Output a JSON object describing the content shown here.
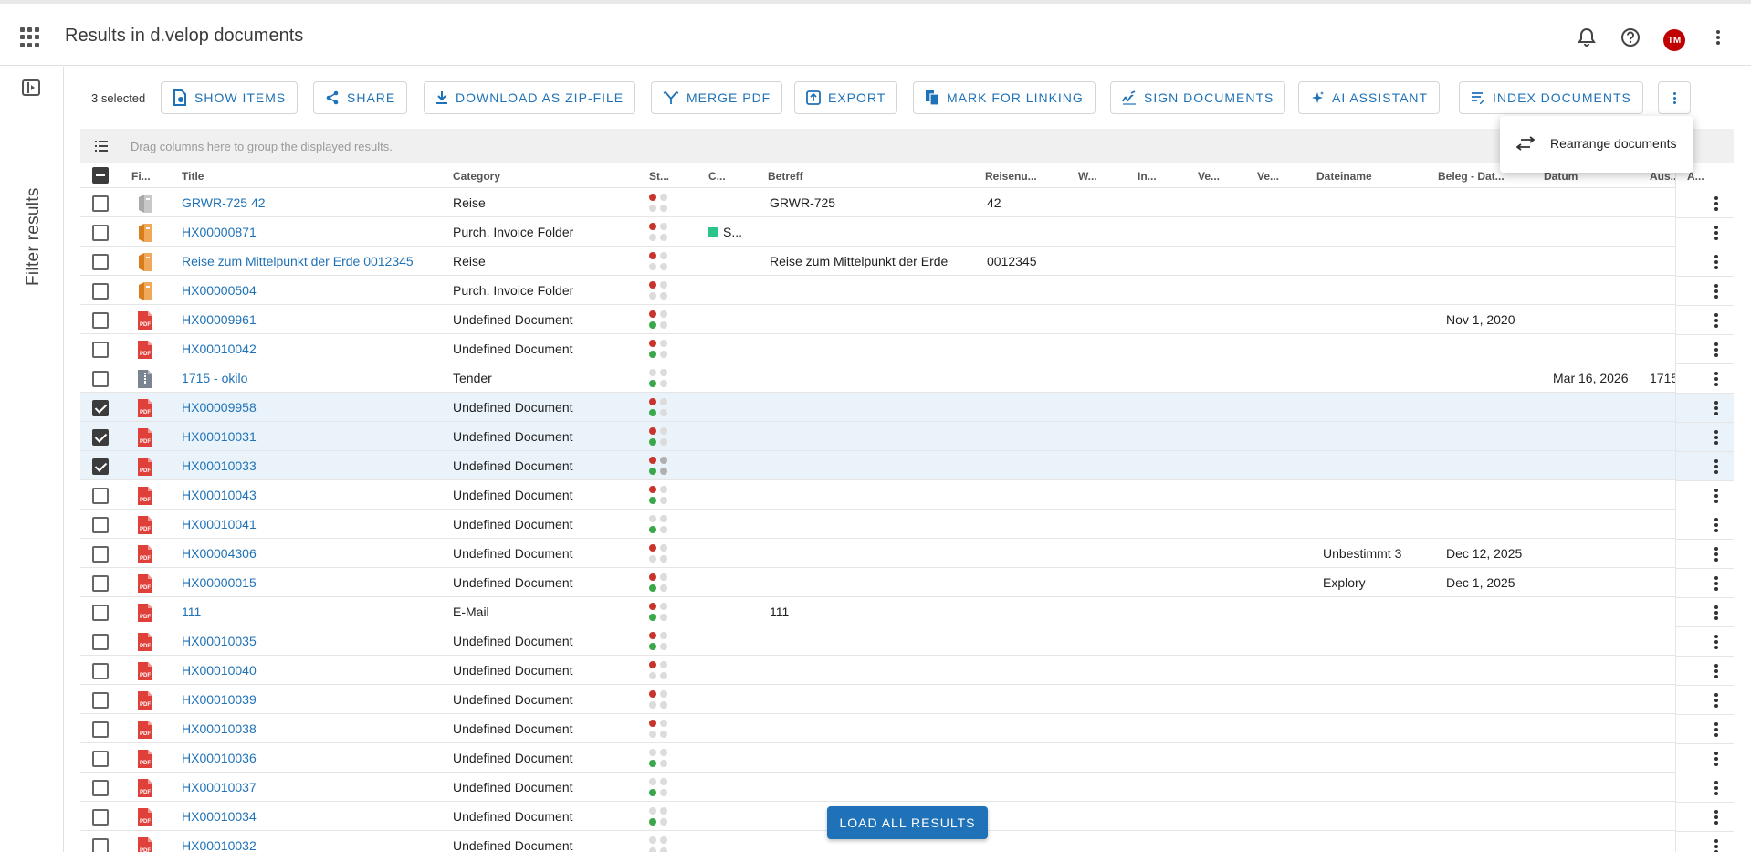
{
  "header": {
    "title": "Results in d.velop documents",
    "avatar_initials": "TM",
    "avatar_color": "#c00000"
  },
  "sidebar": {
    "filter_label": "Filter results"
  },
  "toolbar": {
    "selected_count": "3 selected",
    "buttons": [
      {
        "label": "SHOW ITEMS",
        "icon": "file-eye-icon"
      },
      {
        "label": "SHARE",
        "icon": "share-icon"
      },
      {
        "label": "DOWNLOAD AS ZIP-FILE",
        "icon": "download-icon"
      },
      {
        "label": "MERGE PDF",
        "icon": "merge-icon"
      },
      {
        "label": "EXPORT",
        "icon": "export-icon"
      },
      {
        "label": "MARK FOR LINKING",
        "icon": "link-docs-icon"
      },
      {
        "label": "SIGN DOCUMENTS",
        "icon": "signature-icon"
      },
      {
        "label": "AI ASSISTANT",
        "icon": "sparkle-icon"
      },
      {
        "label": "INDEX DOCUMENTS",
        "icon": "index-icon"
      }
    ]
  },
  "menu": {
    "items": [
      {
        "label": "Rearrange documents",
        "icon": "swap-icon"
      }
    ]
  },
  "group_area": {
    "hint": "Drag columns here to group the displayed results."
  },
  "columns": {
    "file": "Fi...",
    "title": "Title",
    "category": "Category",
    "status": "St...",
    "c": "C...",
    "betreff": "Betreff",
    "reisenu": "Reisenu...",
    "w": "W...",
    "in": "In...",
    "ve1": "Ve...",
    "ve2": "Ve...",
    "dateiname": "Dateiname",
    "beleg": "Beleg - Dat...",
    "datum": "Datum",
    "aus": "Aus...",
    "a": "A..."
  },
  "accent_color": "#1f72b7",
  "rows": [
    {
      "title": "GRWR-725 42",
      "category": "Reise",
      "icon": "folder-gray",
      "status": [
        "r",
        "e",
        "e",
        "e"
      ],
      "betreff": "GRWR-725",
      "reisenu": "42",
      "checked": false
    },
    {
      "title": "HX00000871",
      "category": "Purch. Invoice Folder",
      "icon": "folder-orange",
      "status": [
        "r",
        "e",
        "e",
        "e"
      ],
      "c": "S...",
      "checked": false
    },
    {
      "title": "Reise zum Mittelpunkt der Erde 0012345",
      "category": "Reise",
      "icon": "folder-orange",
      "status": [
        "r",
        "e",
        "e",
        "e"
      ],
      "betreff": "Reise zum Mittelpunkt der Erde",
      "reisenu": "0012345",
      "checked": false
    },
    {
      "title": "HX00000504",
      "category": "Purch. Invoice Folder",
      "icon": "folder-orange",
      "status": [
        "r",
        "e",
        "e",
        "e"
      ],
      "checked": false
    },
    {
      "title": "HX00009961",
      "category": "Undefined Document",
      "icon": "pdf",
      "status": [
        "r",
        "e",
        "g",
        "e"
      ],
      "beleg": "Nov 1, 2020",
      "checked": false
    },
    {
      "title": "HX00010042",
      "category": "Undefined Document",
      "icon": "pdf",
      "status": [
        "r",
        "e",
        "g",
        "e"
      ],
      "checked": false
    },
    {
      "title": "1715 - okilo",
      "category": "Tender",
      "icon": "zip",
      "status": [
        "e",
        "e",
        "g",
        "e"
      ],
      "datum": "Mar 16, 2026",
      "aus": "1715",
      "checked": false
    },
    {
      "title": "HX00009958",
      "category": "Undefined Document",
      "icon": "pdf",
      "status": [
        "r",
        "e",
        "g",
        "e"
      ],
      "checked": true
    },
    {
      "title": "HX00010031",
      "category": "Undefined Document",
      "icon": "pdf",
      "status": [
        "r",
        "e",
        "g",
        "e"
      ],
      "checked": true
    },
    {
      "title": "HX00010033",
      "category": "Undefined Document",
      "icon": "pdf",
      "status": [
        "r",
        "d",
        "g",
        "d"
      ],
      "checked": true
    },
    {
      "title": "HX00010043",
      "category": "Undefined Document",
      "icon": "pdf",
      "status": [
        "r",
        "e",
        "g",
        "e"
      ],
      "checked": false
    },
    {
      "title": "HX00010041",
      "category": "Undefined Document",
      "icon": "pdf",
      "status": [
        "e",
        "e",
        "g",
        "e"
      ],
      "checked": false
    },
    {
      "title": "HX00004306",
      "category": "Undefined Document",
      "icon": "pdf",
      "status": [
        "r",
        "e",
        "e",
        "e"
      ],
      "dateiname": "Unbestimmt 3",
      "beleg": "Dec 12, 2025",
      "checked": false
    },
    {
      "title": "HX00000015",
      "category": "Undefined Document",
      "icon": "pdf",
      "status": [
        "r",
        "e",
        "g",
        "e"
      ],
      "dateiname": "Explory",
      "beleg": "Dec 1, 2025",
      "checked": false
    },
    {
      "title": "111",
      "category": "E-Mail",
      "icon": "pdf",
      "status": [
        "r",
        "e",
        "g",
        "e"
      ],
      "betreff": "111",
      "checked": false
    },
    {
      "title": "HX00010035",
      "category": "Undefined Document",
      "icon": "pdf",
      "status": [
        "r",
        "e",
        "g",
        "e"
      ],
      "checked": false
    },
    {
      "title": "HX00010040",
      "category": "Undefined Document",
      "icon": "pdf",
      "status": [
        "r",
        "e",
        "e",
        "e"
      ],
      "checked": false
    },
    {
      "title": "HX00010039",
      "category": "Undefined Document",
      "icon": "pdf",
      "status": [
        "r",
        "e",
        "e",
        "e"
      ],
      "checked": false
    },
    {
      "title": "HX00010038",
      "category": "Undefined Document",
      "icon": "pdf",
      "status": [
        "r",
        "e",
        "e",
        "e"
      ],
      "checked": false
    },
    {
      "title": "HX00010036",
      "category": "Undefined Document",
      "icon": "pdf",
      "status": [
        "e",
        "e",
        "g",
        "e"
      ],
      "checked": false
    },
    {
      "title": "HX00010037",
      "category": "Undefined Document",
      "icon": "pdf",
      "status": [
        "e",
        "e",
        "g",
        "e"
      ],
      "checked": false
    },
    {
      "title": "HX00010034",
      "category": "Undefined Document",
      "icon": "pdf",
      "status": [
        "e",
        "e",
        "g",
        "e"
      ],
      "checked": false
    },
    {
      "title": "HX00010032",
      "category": "Undefined Document",
      "icon": "pdf",
      "status": [
        "e",
        "e",
        "e",
        "e"
      ],
      "checked": false
    }
  ],
  "load_all_label": "LOAD ALL RESULTS"
}
